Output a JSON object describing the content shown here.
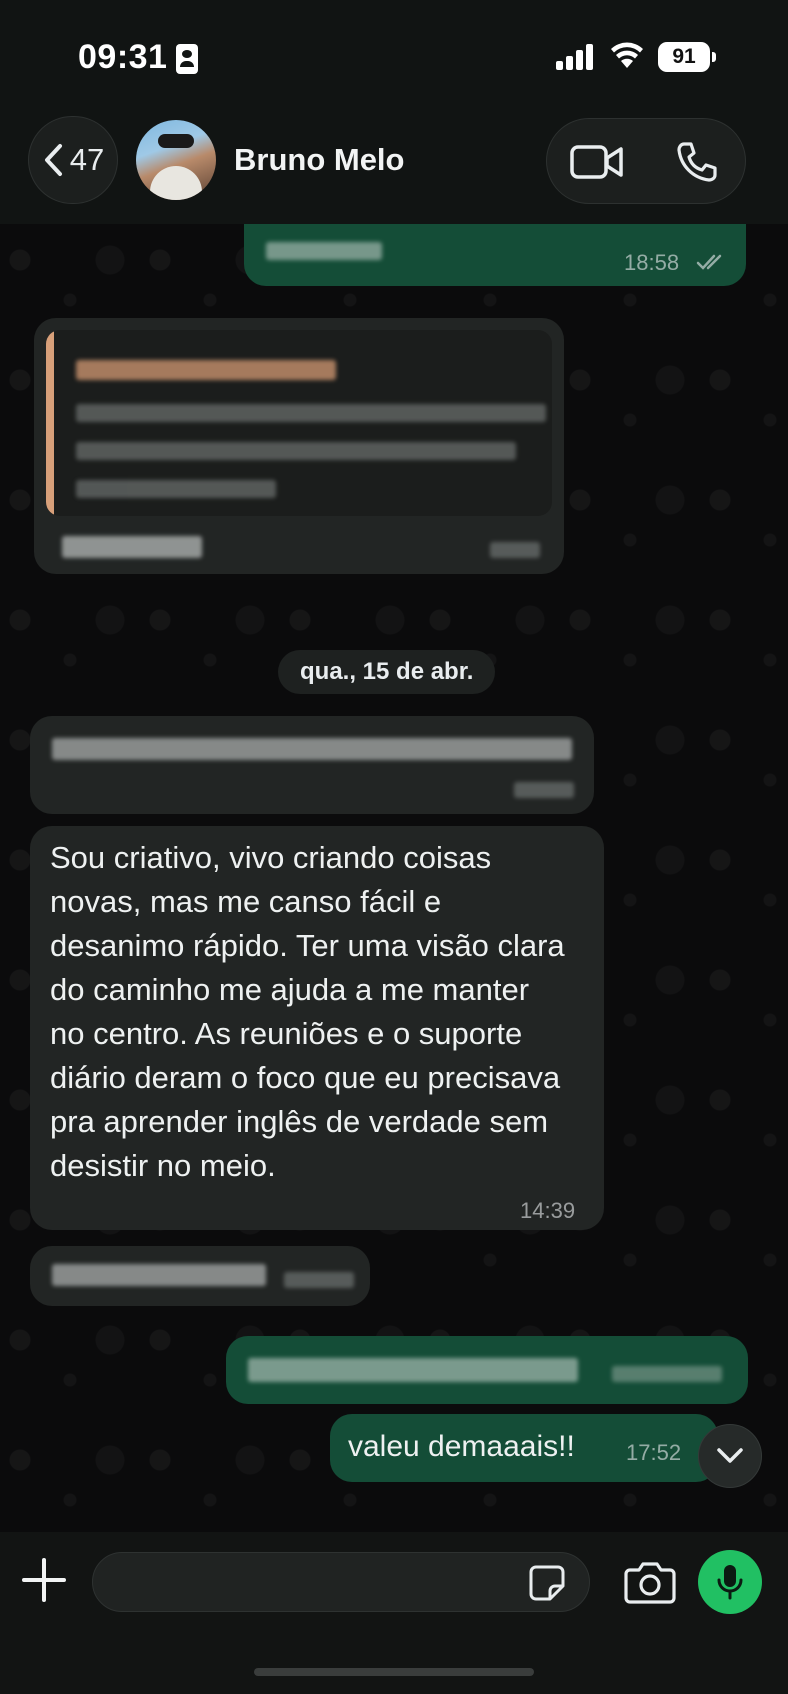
{
  "status_bar": {
    "time": "09:31",
    "battery": "91"
  },
  "header": {
    "back_count": "47",
    "contact_name": "Bruno Melo"
  },
  "messages": {
    "date_separator": "qua., 15 de abr.",
    "first_outgoing_time": "18:58",
    "main_text": "Sou criativo, vivo criando coisas novas, mas me canso fácil e desanimo rápido. Ter uma visão clara do caminho me ajuda a me manter no centro. As reuniões e o suporte diário deram o foco que eu precisava pra aprender inglês de verdade sem desistir no meio.",
    "main_time": "14:39",
    "last_text": "valeu demaaais!!",
    "last_time": "17:52"
  },
  "composer": {
    "placeholder": ""
  },
  "colors": {
    "outgoing_bubble": "#144d37",
    "incoming_bubble": "#222524",
    "mic_button": "#21c063",
    "quote_accent": "#d8a07a"
  },
  "icons": [
    "back-chevron-icon",
    "video-call-icon",
    "phone-icon",
    "double-check-icon",
    "chevron-down-icon",
    "plus-icon",
    "sticker-icon",
    "camera-icon",
    "microphone-icon"
  ]
}
